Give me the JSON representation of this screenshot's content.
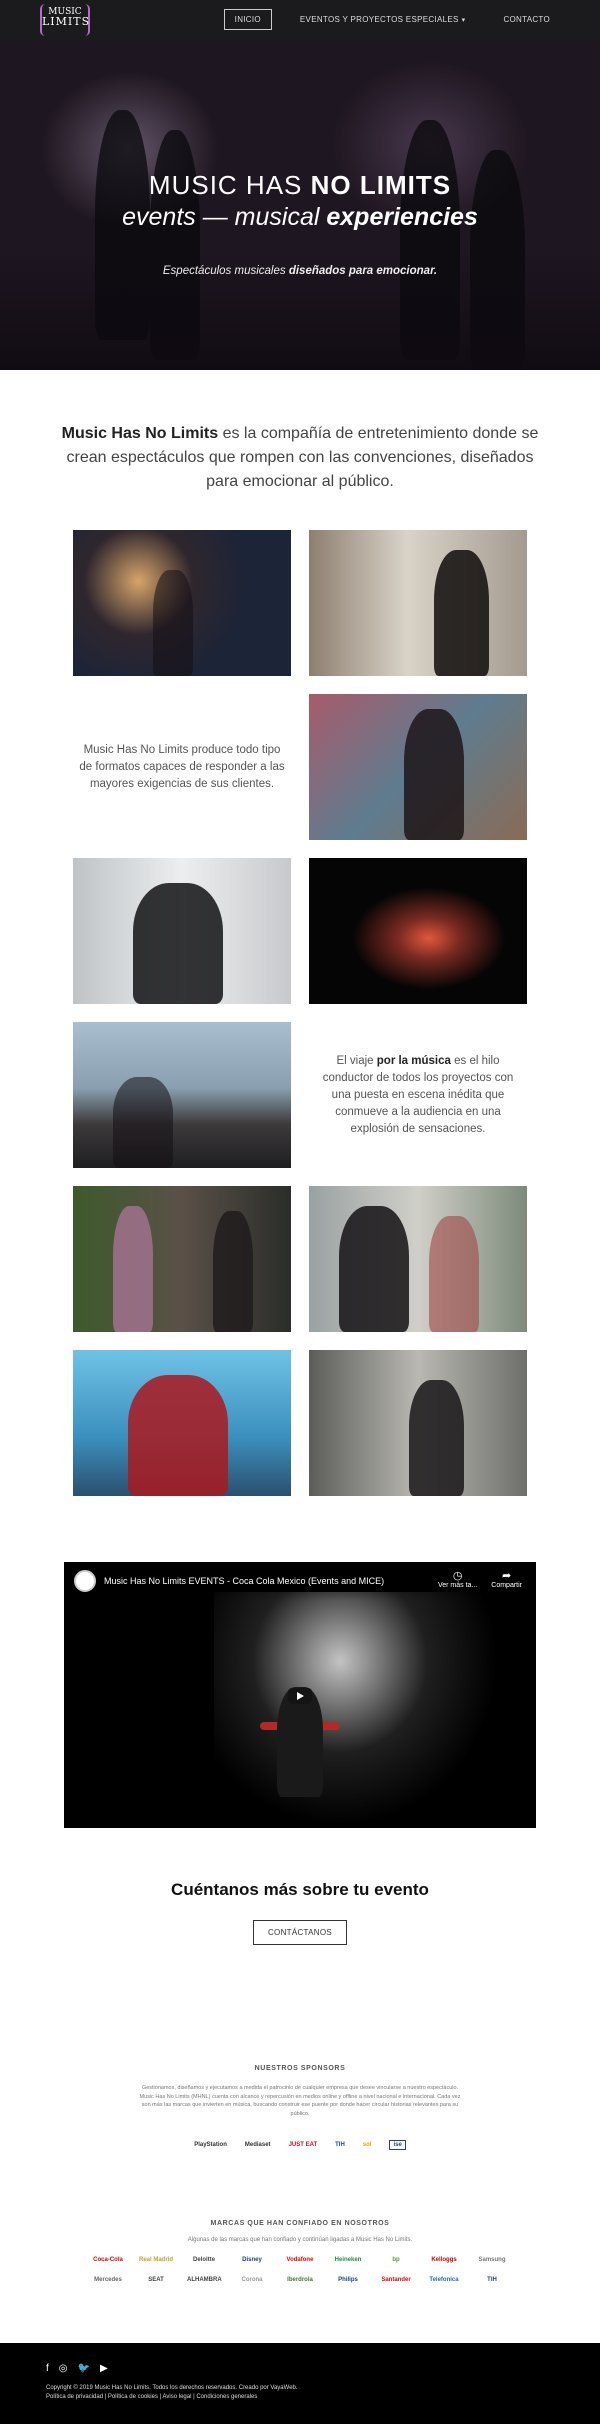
{
  "nav": {
    "logo_line1": "MUSIC",
    "logo_line2": "LIMITS",
    "items": [
      {
        "label": "INICIO"
      },
      {
        "label": "EVENTOS Y PROYECTOS ESPECIALES"
      },
      {
        "label": "CONTACTO"
      }
    ],
    "caret": "▾"
  },
  "hero": {
    "title_light": "MUSIC HAS",
    "title_bold": "NO LIMITS",
    "sub_a": "events — musical",
    "sub_b": "experiencies",
    "tag_a": "Espectáculos musicales",
    "tag_b": "diseñados para emocionar."
  },
  "intro": {
    "brand": "Music Has No Limits",
    "text": " es la compañía de entretenimiento donde se crean espectáculos que rompen con las convenciones, diseñados para emocionar al público."
  },
  "grid_text": {
    "t1": "Music Has No Limits produce todo tipo de formatos capaces de responder a las mayores exigencias de sus clientes.",
    "t2a": "El viaje ",
    "t2b": "por la música",
    "t2c": " es el hilo conductor de todos los proyectos con una puesta en escena inédita que conmueve a la audiencia en una explosión de sensaciones."
  },
  "video": {
    "title": "Music Has No Limits EVENTS - Coca Cola Mexico (Events and MICE)",
    "watch_later": "Ver más ta...",
    "share": "Compartir"
  },
  "cta": {
    "heading": "Cuéntanos más sobre tu evento",
    "button": "CONTÁCTANOS"
  },
  "sponsors": {
    "heading": "NUESTROS SPONSORS",
    "text": "Gestionamos, diseñamos y ejecutamos a medida el patrocinio de cualquier empresa que desee vincularse a nuestro espectáculo. Music Has No Limits (MHNL) cuenta con alcance y repercusión en medios online y offline a nivel nacional e internacional. Cada vez son más las marcas que invierten en música, buscando construir ese puente por donde hacer circular historias relevantes para su público.",
    "logos": [
      "PlayStation",
      "Mediaset",
      "JUST EAT",
      "TIH",
      "sol",
      "ise"
    ]
  },
  "brands": {
    "heading": "MARCAS QUE HAN CONFIADO EN NOSOTROS",
    "sub": "Algunas de las marcas que han confiado y continúan ligadas a Music Has No Limits.",
    "row1": [
      "Coca-Cola",
      "Real Madrid",
      "Deloitte",
      "Disney",
      "Vodafone",
      "Heineken",
      "bp",
      "Kelloggs",
      "Samsung"
    ],
    "row2": [
      "Mercedes",
      "SEAT",
      "ALHAMBRA",
      "Corona",
      "Iberdrola",
      "Philips",
      "Santander",
      "Telefonica",
      "TIH"
    ]
  },
  "footer": {
    "social": [
      "f",
      "◎",
      "🐦",
      "▶"
    ],
    "copy": "Copyright © 2019 Music Has No Limits. Todos los derechos reservados. Creado por VayaWeb.",
    "links": "Política de privacidad | Política de cookies | Aviso legal | Condiciones generales"
  },
  "colors": {
    "accent": "#b86bc4",
    "dark": "#1b1a1d"
  }
}
